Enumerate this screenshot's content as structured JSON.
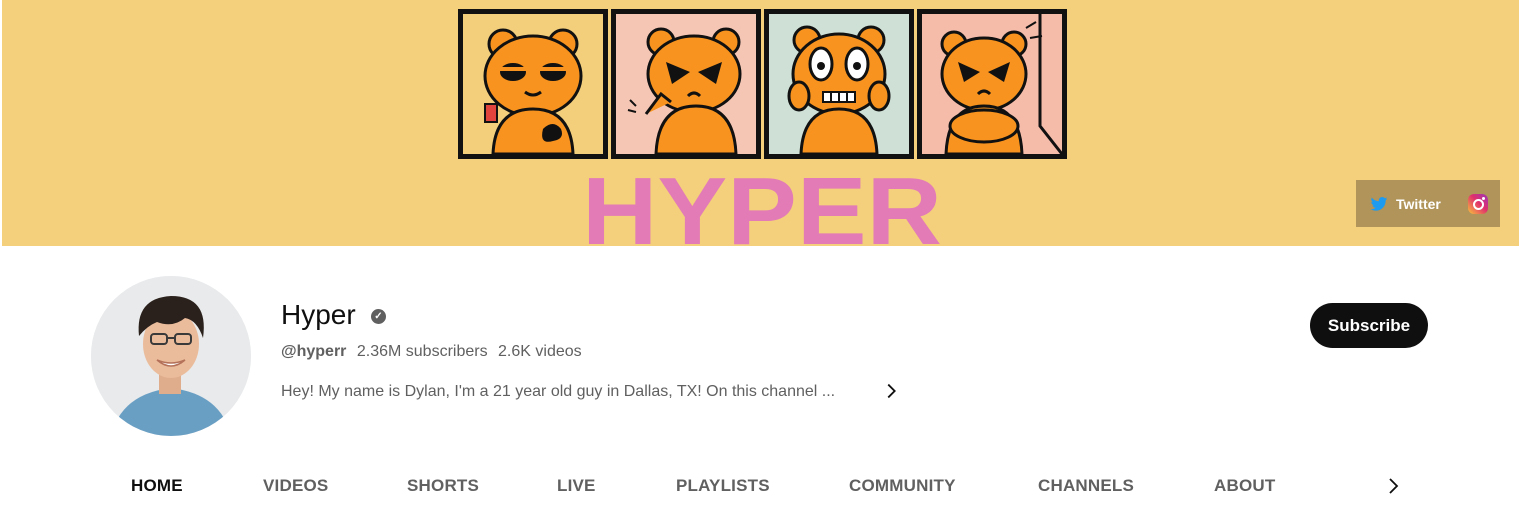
{
  "banner": {
    "title_art": "HYPER",
    "links": {
      "twitter_label": "Twitter",
      "twitter_icon": "twitter-bird-icon",
      "instagram_icon": "instagram-icon"
    },
    "colors": {
      "background": "#f4cf7c",
      "title_pink": "#e27bb6",
      "bear_orange": "#f7931e"
    }
  },
  "channel": {
    "name": "Hyper",
    "verified_icon": "verified-check-icon",
    "handle": "@hyperr",
    "subscribers": "2.36M subscribers",
    "videos": "2.6K videos",
    "description": "Hey! My name is Dylan, I'm a 21 year old guy in Dallas, TX! On this channel ...",
    "description_more_icon": "chevron-right-icon"
  },
  "subscribe_label": "Subscribe",
  "tabs": [
    {
      "label": "HOME",
      "active": true
    },
    {
      "label": "VIDEOS",
      "active": false
    },
    {
      "label": "SHORTS",
      "active": false
    },
    {
      "label": "LIVE",
      "active": false
    },
    {
      "label": "PLAYLISTS",
      "active": false
    },
    {
      "label": "COMMUNITY",
      "active": false
    },
    {
      "label": "CHANNELS",
      "active": false
    },
    {
      "label": "ABOUT",
      "active": false
    }
  ],
  "tabs_next_icon": "chevron-right-icon"
}
